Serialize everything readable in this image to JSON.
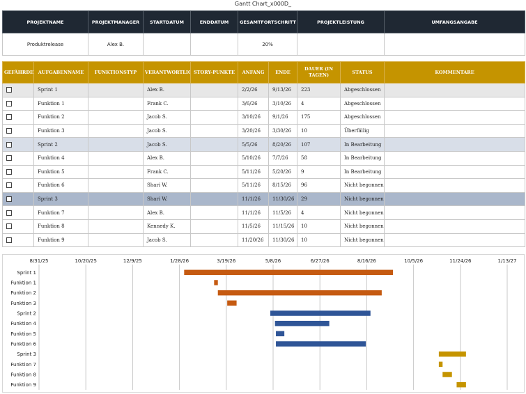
{
  "title": "Gantt Chart_x000D_",
  "project_table": {
    "headers": [
      "PROJEKTNAME",
      "PROJEKTMANAGER",
      "STARTDATUM",
      "ENDDATUM",
      "GESAMTFORTSCHRITT",
      "PROJEKTLEISTUNG",
      "UMFANGSANGABE"
    ],
    "values": [
      "Produktrelease",
      "Alex B.",
      "",
      "",
      "20%",
      "",
      ""
    ]
  },
  "task_table": {
    "headers": [
      "GEFÄHRDET",
      "AUFGABENNAME",
      "FUNKTIONSTYP",
      "VERANTWORTLICH",
      "STORY-PUNKTE",
      "ANFANG",
      "ENDE",
      "DAUER (IN TAGEN)",
      "STATUS",
      "KOMMENTARE"
    ],
    "rows": [
      {
        "kind": "sprint1",
        "name": "Sprint 1",
        "type": "",
        "owner": "Alex B.",
        "points": "",
        "start": "2/2/26",
        "end": "9/13/26",
        "days": "223",
        "status": "Abgeschlossen",
        "comment": ""
      },
      {
        "kind": "task",
        "name": "Funktion 1",
        "type": "",
        "owner": "Frank C.",
        "points": "",
        "start": "3/6/26",
        "end": "3/10/26",
        "days": "4",
        "status": "Abgeschlossen",
        "comment": ""
      },
      {
        "kind": "task",
        "name": "Funktion 2",
        "type": "",
        "owner": "Jacob S.",
        "points": "",
        "start": "3/10/26",
        "end": "9/1/26",
        "days": "175",
        "status": "Abgeschlossen",
        "comment": ""
      },
      {
        "kind": "task",
        "name": "Funktion 3",
        "type": "",
        "owner": "Jacob S.",
        "points": "",
        "start": "3/20/26",
        "end": "3/30/26",
        "days": "10",
        "status": "Überfällig",
        "comment": ""
      },
      {
        "kind": "sprint2",
        "name": "Sprint 2",
        "type": "",
        "owner": "Jacob S.",
        "points": "",
        "start": "5/5/26",
        "end": "8/20/26",
        "days": "107",
        "status": "In Bearbeitung",
        "comment": ""
      },
      {
        "kind": "task",
        "name": "Funktion 4",
        "type": "",
        "owner": "Alex B.",
        "points": "",
        "start": "5/10/26",
        "end": "7/7/26",
        "days": "58",
        "status": "In Bearbeitung",
        "comment": ""
      },
      {
        "kind": "task",
        "name": "Funktion 5",
        "type": "",
        "owner": "Frank C.",
        "points": "",
        "start": "5/11/26",
        "end": "5/20/26",
        "days": "9",
        "status": "In Bearbeitung",
        "comment": ""
      },
      {
        "kind": "task",
        "name": "Funktion 6",
        "type": "",
        "owner": "Shari W.",
        "points": "",
        "start": "5/11/26",
        "end": "8/15/26",
        "days": "96",
        "status": "Nicht begonnen",
        "comment": ""
      },
      {
        "kind": "sprint3",
        "name": "Sprint 3",
        "type": "",
        "owner": "Shari W.",
        "points": "",
        "start": "11/1/26",
        "end": "11/30/26",
        "days": "29",
        "status": "Nicht begonnen",
        "comment": ""
      },
      {
        "kind": "task",
        "name": "Funktion 7",
        "type": "",
        "owner": "Alex B.",
        "points": "",
        "start": "11/1/26",
        "end": "11/5/26",
        "days": "4",
        "status": "Nicht begonnen",
        "comment": ""
      },
      {
        "kind": "task",
        "name": "Funktion 8",
        "type": "",
        "owner": "Kennedy K.",
        "points": "",
        "start": "11/5/26",
        "end": "11/15/26",
        "days": "10",
        "status": "Nicht begonnen",
        "comment": ""
      },
      {
        "kind": "task",
        "name": "Funktion 9",
        "type": "",
        "owner": "Jacob S.",
        "points": "",
        "start": "11/20/26",
        "end": "11/30/26",
        "days": "10",
        "status": "Nicht begonnen",
        "comment": ""
      }
    ]
  },
  "chart_data": {
    "type": "bar",
    "orientation": "horizontal-gantt",
    "categories": [
      "Sprint 1",
      "Funktion 1",
      "Funktion 2",
      "Funktion 3",
      "Sprint 2",
      "Funktion 4",
      "Funktion 5",
      "Funktion 6",
      "Sprint 3",
      "Funktion 7",
      "Funktion 8",
      "Funktion 9"
    ],
    "start": [
      "2026-02-02",
      "2026-03-06",
      "2026-03-10",
      "2026-03-20",
      "2026-05-05",
      "2026-05-10",
      "2026-05-11",
      "2026-05-11",
      "2026-11-01",
      "2026-11-01",
      "2026-11-05",
      "2026-11-20"
    ],
    "end": [
      "2026-09-13",
      "2026-03-10",
      "2026-09-01",
      "2026-03-30",
      "2026-08-20",
      "2026-07-07",
      "2026-05-20",
      "2026-08-15",
      "2026-11-30",
      "2026-11-05",
      "2026-11-15",
      "2026-11-30"
    ],
    "groups": [
      "sprint1",
      "sprint1",
      "sprint1",
      "sprint1",
      "sprint2",
      "sprint2",
      "sprint2",
      "sprint2",
      "sprint3",
      "sprint3",
      "sprint3",
      "sprint3"
    ],
    "group_colors": {
      "sprint1": "#c55a11",
      "sprint2": "#2f5597",
      "sprint3": "#c59400"
    },
    "x_tick_labels": [
      "8/31/25",
      "10/20/25",
      "12/9/25",
      "1/28/26",
      "3/19/26",
      "5/8/26",
      "6/27/26",
      "8/16/26",
      "10/5/26",
      "11/24/26",
      "1/13/27"
    ],
    "x_ticks": [
      "2025-08-31",
      "2025-10-20",
      "2025-12-09",
      "2026-01-28",
      "2026-03-19",
      "2026-05-08",
      "2026-06-27",
      "2026-08-16",
      "2026-10-05",
      "2026-11-24",
      "2027-01-13"
    ],
    "xlim": [
      "2025-08-31",
      "2027-01-13"
    ],
    "x_axis_position": "top",
    "grid": true,
    "legend": "none",
    "title": "",
    "xlabel": "",
    "ylabel": ""
  }
}
